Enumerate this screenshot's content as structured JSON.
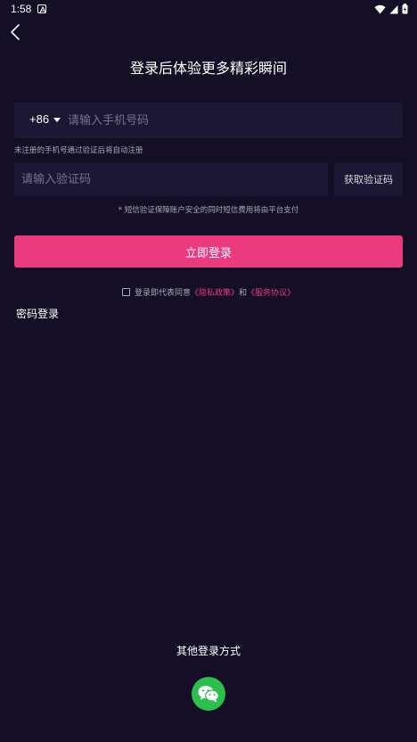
{
  "status_bar": {
    "time": "1:58",
    "icons": [
      "wifi-icon",
      "signal-icon",
      "battery-icon"
    ]
  },
  "header": {
    "title": "登录后体验更多精彩瞬间"
  },
  "phone": {
    "country_code": "+86",
    "placeholder": "请输入手机号码",
    "value": ""
  },
  "hint_unregistered": "未注册的手机号通过验证后将自动注册",
  "code": {
    "placeholder": "请输入验证码",
    "value": "",
    "get_code_label": "获取验证码"
  },
  "sms_hint": "* 短信验证保障账户安全的同时短信费用将由平台支付",
  "login_button_label": "立即登录",
  "agreement": {
    "checked": false,
    "prefix": "登录即代表同意",
    "privacy_link": "《隐私政策》",
    "conjunction": "和",
    "service_link": "《服务协议》"
  },
  "password_login_label": "密码登录",
  "other_login": {
    "title": "其他登录方式",
    "methods": [
      "wechat-icon"
    ]
  },
  "colors": {
    "background": "#140f26",
    "input_background": "#1c1735",
    "accent": "#eb3a7e",
    "wechat": "#2bc04d"
  }
}
